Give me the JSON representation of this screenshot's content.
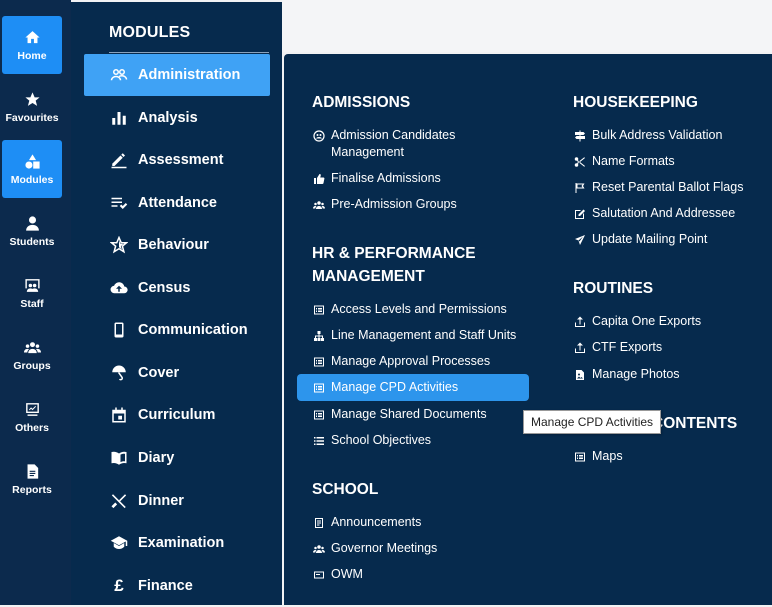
{
  "rail": {
    "items": [
      {
        "label": "Home",
        "icon": "home-icon",
        "active": true
      },
      {
        "label": "Favourites",
        "icon": "star-icon",
        "active": false
      },
      {
        "label": "Modules",
        "icon": "shapes-icon",
        "active": true
      },
      {
        "label": "Students",
        "icon": "person-icon",
        "active": false
      },
      {
        "label": "Staff",
        "icon": "staff-board-icon",
        "active": false
      },
      {
        "label": "Groups",
        "icon": "groups-icon",
        "active": false
      },
      {
        "label": "Others",
        "icon": "others-icon",
        "active": false
      },
      {
        "label": "Reports",
        "icon": "report-icon",
        "active": false
      }
    ]
  },
  "modules": {
    "title": "MODULES",
    "items": [
      {
        "label": "Administration",
        "icon": "people-icon",
        "active": true
      },
      {
        "label": "Analysis",
        "icon": "bar-chart-icon"
      },
      {
        "label": "Assessment",
        "icon": "pencil-icon"
      },
      {
        "label": "Attendance",
        "icon": "list-check-icon"
      },
      {
        "label": "Behaviour",
        "icon": "star-outline-icon"
      },
      {
        "label": "Census",
        "icon": "cloud-upload-icon"
      },
      {
        "label": "Communication",
        "icon": "phone-icon"
      },
      {
        "label": "Cover",
        "icon": "umbrella-icon"
      },
      {
        "label": "Curriculum",
        "icon": "calendar-icon"
      },
      {
        "label": "Diary",
        "icon": "book-open-icon"
      },
      {
        "label": "Dinner",
        "icon": "cutlery-icon"
      },
      {
        "label": "Examination",
        "icon": "graduation-cap-icon"
      },
      {
        "label": "Finance",
        "icon": "pound-icon"
      }
    ]
  },
  "submenu": {
    "admissions": {
      "title": "ADMISSIONS",
      "links": [
        {
          "label": "Admission Candidates Management",
          "icon": "candidates-icon"
        },
        {
          "label": "Finalise Admissions",
          "icon": "thumbs-up-icon"
        },
        {
          "label": "Pre-Admission Groups",
          "icon": "group-icon"
        }
      ]
    },
    "hr": {
      "title_line1": "HR & PERFORMANCE",
      "title_line2": "MANAGEMENT",
      "links": [
        {
          "label": "Access Levels and Permissions",
          "icon": "list-icon"
        },
        {
          "label": "Line Management and Staff Units",
          "icon": "hierarchy-icon"
        },
        {
          "label": "Manage Approval Processes",
          "icon": "list-icon"
        },
        {
          "label": "Manage CPD Activities",
          "icon": "list-icon",
          "highlighted": true
        },
        {
          "label": "Manage Shared Documents",
          "icon": "list-icon"
        },
        {
          "label": "School Objectives",
          "icon": "bullet-list-icon"
        }
      ]
    },
    "school": {
      "title": "SCHOOL",
      "links": [
        {
          "label": "Announcements",
          "icon": "announcement-icon"
        },
        {
          "label": "Governor Meetings",
          "icon": "group-icon"
        },
        {
          "label": "OWM",
          "icon": "card-icon"
        }
      ]
    },
    "housekeeping": {
      "title": "HOUSEKEEPING",
      "links": [
        {
          "label": "Bulk Address Validation",
          "icon": "signpost-icon"
        },
        {
          "label": "Name Formats",
          "icon": "scissors-icon"
        },
        {
          "label": "Reset Parental Ballot Flags",
          "icon": "flag-icon"
        },
        {
          "label": "Salutation And Addressee",
          "icon": "edit-icon"
        },
        {
          "label": "Update Mailing Point",
          "icon": "send-icon"
        }
      ]
    },
    "routines": {
      "title": "ROUTINES",
      "links": [
        {
          "label": "Capita One Exports",
          "icon": "export-icon"
        },
        {
          "label": "CTF Exports",
          "icon": "export-icon"
        },
        {
          "label": "Manage Photos",
          "icon": "photo-file-icon"
        }
      ]
    },
    "contents": {
      "title": "CONTENTS",
      "links": [
        {
          "label": "Maps",
          "icon": "list-icon"
        }
      ]
    }
  },
  "tooltip": "Manage CPD Activities",
  "colors": {
    "rail_bg": "#0c2a4d",
    "panel_bg": "#062a4d",
    "active_blue": "#1e8ef5",
    "highlight_blue": "#2d95ec"
  }
}
